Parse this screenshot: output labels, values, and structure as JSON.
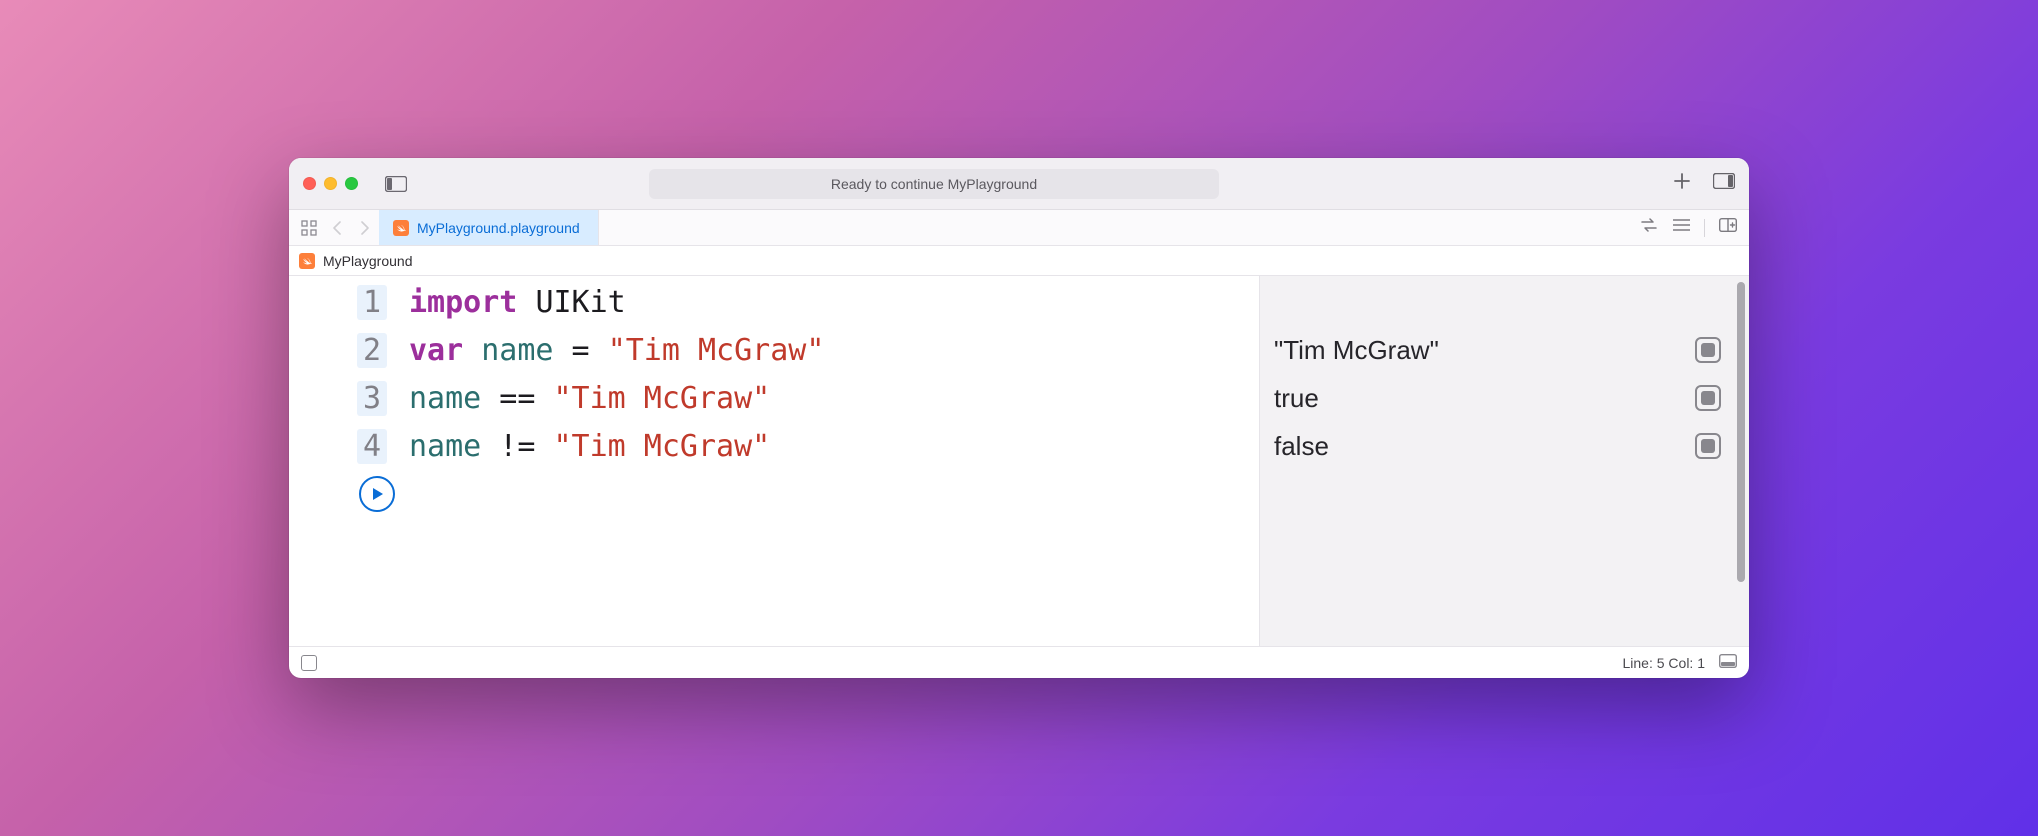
{
  "titlebar": {
    "status": "Ready to continue MyPlayground"
  },
  "tab": {
    "label": "MyPlayground.playground"
  },
  "breadcrumb": {
    "label": "MyPlayground"
  },
  "code": {
    "lines": [
      {
        "n": "1",
        "tokens": [
          {
            "t": "import",
            "c": "kw-import"
          },
          {
            "t": " ",
            "c": "op"
          },
          {
            "t": "UIKit",
            "c": "framework"
          }
        ]
      },
      {
        "n": "2",
        "tokens": [
          {
            "t": "var",
            "c": "kw-var"
          },
          {
            "t": " ",
            "c": "op"
          },
          {
            "t": "name",
            "c": "identifier"
          },
          {
            "t": " = ",
            "c": "op"
          },
          {
            "t": "\"Tim McGraw\"",
            "c": "string"
          }
        ]
      },
      {
        "n": "3",
        "tokens": [
          {
            "t": "name",
            "c": "identifier"
          },
          {
            "t": " == ",
            "c": "op"
          },
          {
            "t": "\"Tim McGraw\"",
            "c": "string"
          }
        ]
      },
      {
        "n": "4",
        "tokens": [
          {
            "t": "name",
            "c": "identifier"
          },
          {
            "t": " != ",
            "c": "op"
          },
          {
            "t": "\"Tim McGraw\"",
            "c": "string"
          }
        ]
      }
    ]
  },
  "results": {
    "rows": [
      "\"Tim McGraw\"",
      "true",
      "false"
    ]
  },
  "footer": {
    "cursor": "Line: 5  Col: 1"
  }
}
